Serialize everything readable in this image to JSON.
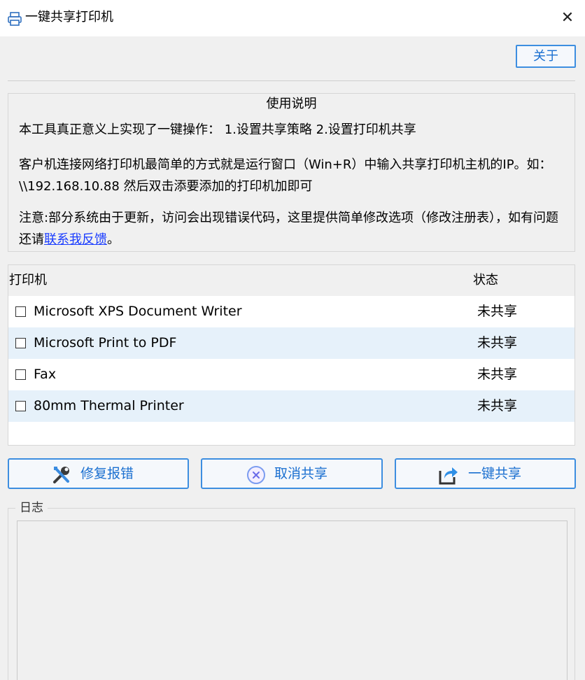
{
  "window": {
    "title": "一键共享打印机",
    "close_glyph": "✕"
  },
  "toolbar": {
    "about_label": "关于"
  },
  "instructions": {
    "title": "使用说明",
    "line1": "本工具真正意义上实现了一键操作：  1.设置共享策略 2.设置打印机共享",
    "line2": "客户机连接网络打印机最简单的方式就是运行窗口（Win+R）中输入共享打印机主机的IP。如：\\\\192.168.10.88 然后双击添要添加的打印机加即可",
    "line3_prefix": "注意:部分系统由于更新，访问会出现错误代码，这里提供简单修改选项（修改注册表），如有问题还请",
    "line3_link": "联系我反馈",
    "line3_suffix": "。"
  },
  "printer_list": {
    "columns": [
      "打印机",
      "状态"
    ],
    "rows": [
      {
        "name": "Microsoft XPS Document Writer",
        "status": "未共享",
        "checked": false
      },
      {
        "name": "Microsoft Print to PDF",
        "status": "未共享",
        "checked": false
      },
      {
        "name": "Fax",
        "status": "未共享",
        "checked": false
      },
      {
        "name": "80mm Thermal Printer",
        "status": "未共享",
        "checked": false
      }
    ]
  },
  "actions": {
    "repair_label": "修复报错",
    "cancel_share_label": "取消共享",
    "one_click_share_label": "一键共享"
  },
  "log": {
    "label": "日志",
    "content": ""
  },
  "icons": {
    "app": "printer-icon",
    "repair": "wrench-screwdriver-icon",
    "cancel": "circle-x-icon",
    "share": "share-arrow-icon"
  },
  "colors": {
    "accent": "#3d8ee0",
    "accent_text": "#1a6fd0",
    "link": "#1a3cff",
    "row_alt": "#e6f1fa"
  }
}
